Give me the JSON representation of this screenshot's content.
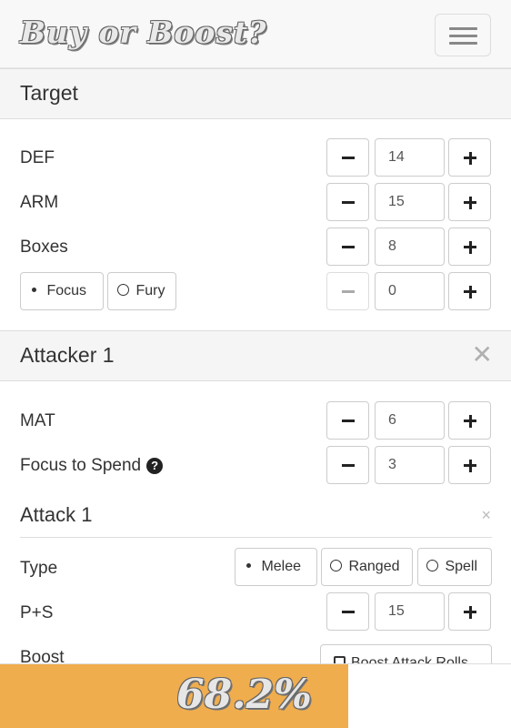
{
  "app": {
    "brand": "Buy or Boost?"
  },
  "target": {
    "title": "Target",
    "def": {
      "label": "DEF",
      "value": "14"
    },
    "arm": {
      "label": "ARM",
      "value": "15"
    },
    "boxes": {
      "label": "Boxes",
      "value": "8"
    },
    "resource": {
      "options": [
        "Focus",
        "Fury"
      ],
      "selected": "Focus",
      "value": "0"
    }
  },
  "attacker": {
    "title": "Attacker 1",
    "mat": {
      "label": "MAT",
      "value": "6"
    },
    "focus_to_spend": {
      "label": "Focus to Spend",
      "value": "3"
    },
    "attack": {
      "title": "Attack 1",
      "close": "×",
      "type": {
        "label": "Type",
        "options": [
          "Melee",
          "Ranged",
          "Spell"
        ],
        "selected": "Melee"
      },
      "ps": {
        "label": "P+S",
        "value": "15"
      },
      "boost": {
        "label": "Boost",
        "option": "Boost Attack Rolls"
      }
    }
  },
  "result": {
    "percent_label": "68.2%",
    "fraction": 0.682
  },
  "colors": {
    "accent": "#f0ad4e",
    "header_bg": "#f5f5f5",
    "navbar_bg": "#f8f8f8"
  },
  "icons": [
    "menu-icon",
    "close-icon",
    "question-circle-icon",
    "minus-icon",
    "plus-icon",
    "radio-icon",
    "checkbox-icon"
  ]
}
